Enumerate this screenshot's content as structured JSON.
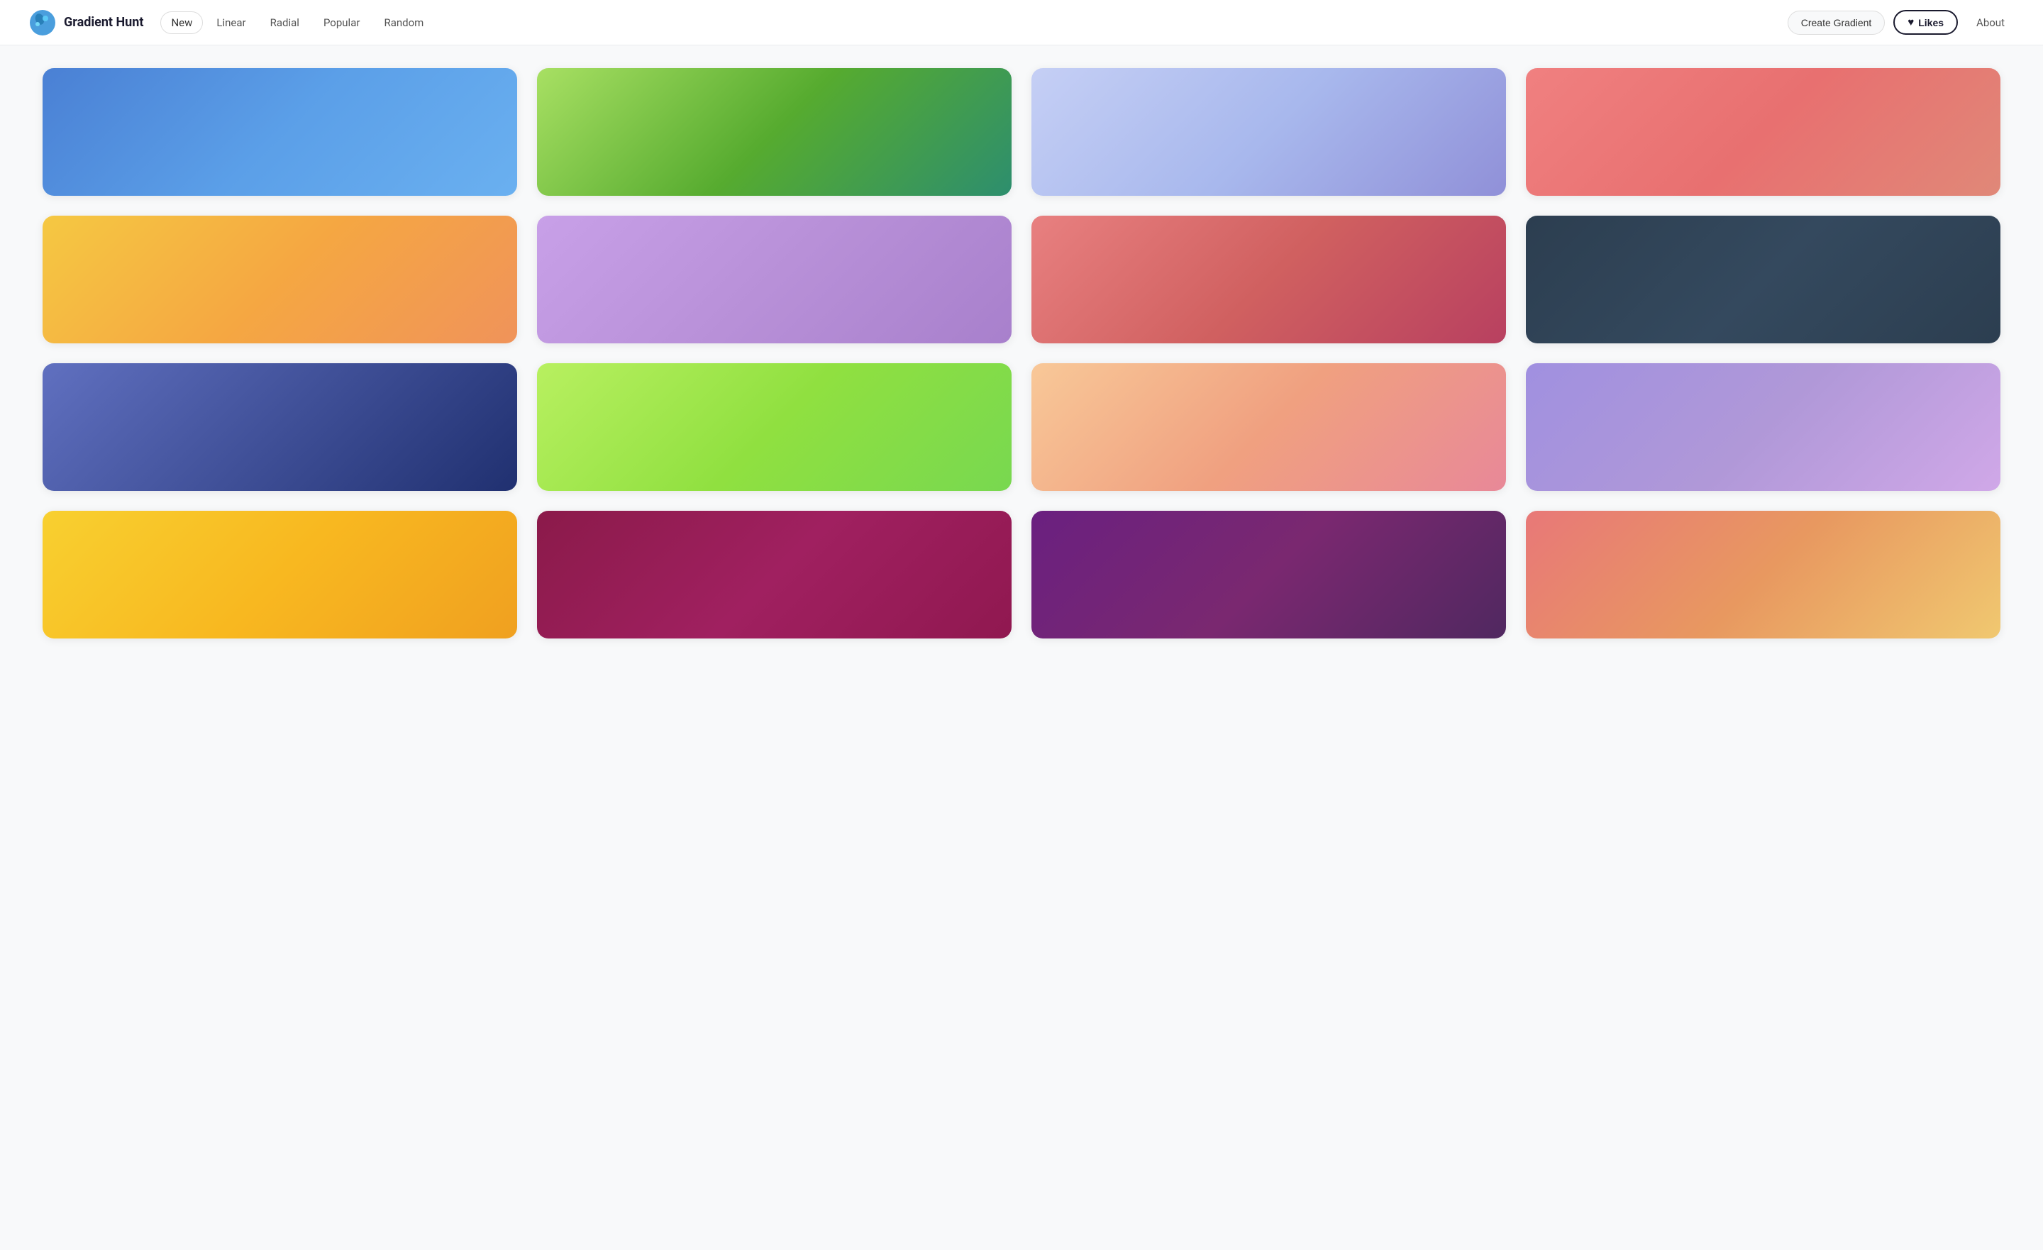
{
  "header": {
    "logo_text": "Gradient Hunt",
    "nav_items": [
      {
        "label": "New",
        "active": false
      },
      {
        "label": "Linear",
        "active": false
      },
      {
        "label": "Radial",
        "active": false
      },
      {
        "label": "Popular",
        "active": false
      },
      {
        "label": "Random",
        "active": false
      }
    ],
    "create_button_label": "Create Gradient",
    "likes_button_label": "Likes",
    "about_label": "About"
  },
  "gradients": [
    {
      "id": 1,
      "css": "linear-gradient(135deg, #4a80d4 0%, #5b9fe8 50%, #6ab0f0 100%)"
    },
    {
      "id": 2,
      "css": "linear-gradient(135deg, #a8e063 0%, #56ab2f 50%, #2d8e6e 100%)"
    },
    {
      "id": 3,
      "css": "linear-gradient(135deg, #c5cff5 0%, #a8b8ed 50%, #9090d8 100%)"
    },
    {
      "id": 4,
      "css": "linear-gradient(135deg, #f08080 0%, #e87070 50%, #e08878 100%)"
    },
    {
      "id": 5,
      "css": "linear-gradient(135deg, #f5c842 0%, #f5a742 50%, #f0935a 100%)"
    },
    {
      "id": 6,
      "css": "linear-gradient(135deg, #c8a0e8 0%, #b890d8 50%, #a880cc 100%)"
    },
    {
      "id": 7,
      "css": "linear-gradient(135deg, #e88080 0%, #d06060 50%, #b84060 100%)"
    },
    {
      "id": 8,
      "css": "linear-gradient(135deg, #2c3e50 0%, #34495e 50%, #2c3e50 100%)"
    },
    {
      "id": 9,
      "css": "linear-gradient(135deg, #6070c0 0%, #405098 50%, #203070 100%)"
    },
    {
      "id": 10,
      "css": "linear-gradient(135deg, #b8f060 0%, #90e040 50%, #78d850 100%)"
    },
    {
      "id": 11,
      "css": "linear-gradient(135deg, #f8c898 0%, #f0a080 50%, #e88898 100%)"
    },
    {
      "id": 12,
      "css": "linear-gradient(135deg, #a090e0 0%, #b098d8 50%, #d0a8e8 100%)"
    },
    {
      "id": 13,
      "css": "linear-gradient(135deg, #f8d030 0%, #f8b820 50%, #f0a020 100%)"
    },
    {
      "id": 14,
      "css": "linear-gradient(135deg, #8b1a4a 0%, #a02060 50%, #901850 100%)"
    },
    {
      "id": 15,
      "css": "linear-gradient(135deg, #6a2080 0%, #7a2870 50%, #502860 100%)"
    },
    {
      "id": 16,
      "css": "linear-gradient(135deg, #e87878 0%, #e89860 50%, #f0c870 100%)"
    }
  ]
}
